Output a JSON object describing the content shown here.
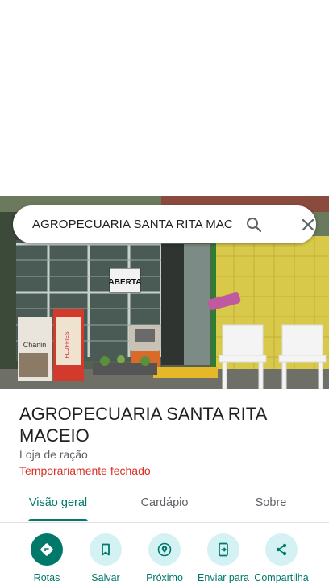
{
  "search": {
    "query": "AGROPECUARIA SANTA RITA MACEI"
  },
  "photo": {
    "sign_text": "ABERTA",
    "bag_label_1": "Chanin",
    "bag_label_2": "FLUFFIES"
  },
  "place": {
    "name": "AGROPECUARIA SANTA RITA MACEIO",
    "category": "Loja de ração",
    "status": "Temporariamente fechado"
  },
  "tabs": [
    {
      "label": "Visão geral",
      "active": true
    },
    {
      "label": "Cardápio",
      "active": false
    },
    {
      "label": "Sobre",
      "active": false
    }
  ],
  "actions": [
    {
      "label": "Rotas",
      "icon": "directions-icon"
    },
    {
      "label": "Salvar",
      "icon": "bookmark-icon"
    },
    {
      "label": "Próximo",
      "icon": "nearby-icon"
    },
    {
      "label": "Enviar para",
      "icon": "send-to-phone-icon"
    },
    {
      "label": "Compartilha",
      "icon": "share-icon"
    }
  ],
  "colors": {
    "accent": "#00796b",
    "action_bg": "#d4f2f4",
    "status": "#d93025"
  }
}
